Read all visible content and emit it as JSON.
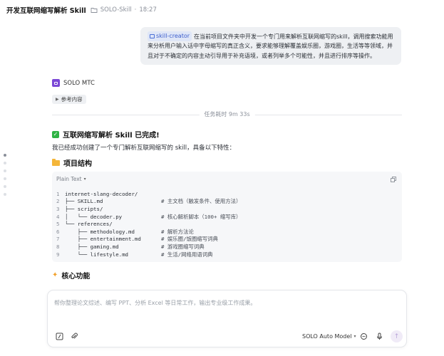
{
  "window": {
    "title": "开发互联网缩写解析 Skill",
    "project": "SOLO-Skill",
    "time": "18:27"
  },
  "user_message": {
    "tag": "skill-creator",
    "text": "在当前项目文件夹中开发一个专门用来解析互联网缩写的skill，调用搜索功能用来分析用户输入话中字母缩写的真正含义，要求能够理解覆盖娱乐圈，游戏圈，生活等等领域，并且对于不确定的内容主动引导用于补充语境，或者列举多个可能性，并且进行排序等操作。"
  },
  "agent": {
    "name": "SOLO MTC"
  },
  "reference_button": {
    "label": "参考内容"
  },
  "duration": {
    "label": "任务耗时 9m 33s"
  },
  "done_heading": {
    "text": "互联网缩写解析 Skill 已完成!"
  },
  "intro_text": "我已经成功创建了一个专门解析互联网缩写的 skill，具备以下特性：",
  "structure_heading": {
    "text": "项目结构"
  },
  "code_block": {
    "language": "Plain Text",
    "lines": [
      {
        "n": "1",
        "code": "internet-slang-decoder/",
        "comment": ""
      },
      {
        "n": "2",
        "code": "├── SKILL.md",
        "comment": "# 主文档（触发条件、使用方法）"
      },
      {
        "n": "3",
        "code": "├── scripts/",
        "comment": ""
      },
      {
        "n": "4",
        "code": "│   └── decoder.py",
        "comment": "# 核心解析脚本（100+ 缩写库）"
      },
      {
        "n": "5",
        "code": "└── references/",
        "comment": ""
      },
      {
        "n": "6",
        "code": "    ├── methodology.md",
        "comment": "# 解析方法论"
      },
      {
        "n": "7",
        "code": "    ├── entertainment.md",
        "comment": "# 娱乐圈/饭圈缩写词典"
      },
      {
        "n": "8",
        "code": "    ├── gaming.md",
        "comment": "# 游戏圈缩写词典"
      },
      {
        "n": "9",
        "code": "    └── lifestyle.md",
        "comment": "# 生活/网络用语词典"
      }
    ]
  },
  "features_heading": {
    "text": "核心功能"
  },
  "composer": {
    "placeholder": "帮你整理论文综述、编写 PPT、分析 Excel 等日常工作，输出专业级工作成果。",
    "model": "SOLO Auto Model"
  },
  "colors": {
    "accent": "#7b48d6",
    "tag_bg": "#dfe6f7",
    "tag_text": "#3d5ecc",
    "success": "#2fb344"
  },
  "icons": [
    "folder-icon",
    "skill-tag-icon",
    "solo-logo-icon",
    "check-icon",
    "folder-emoji-icon",
    "sparkle-icon",
    "copy-icon",
    "slash-command-icon",
    "attach-icon",
    "chat-icon",
    "mic-icon",
    "send-arrow-icon",
    "chevron-down-icon"
  ]
}
